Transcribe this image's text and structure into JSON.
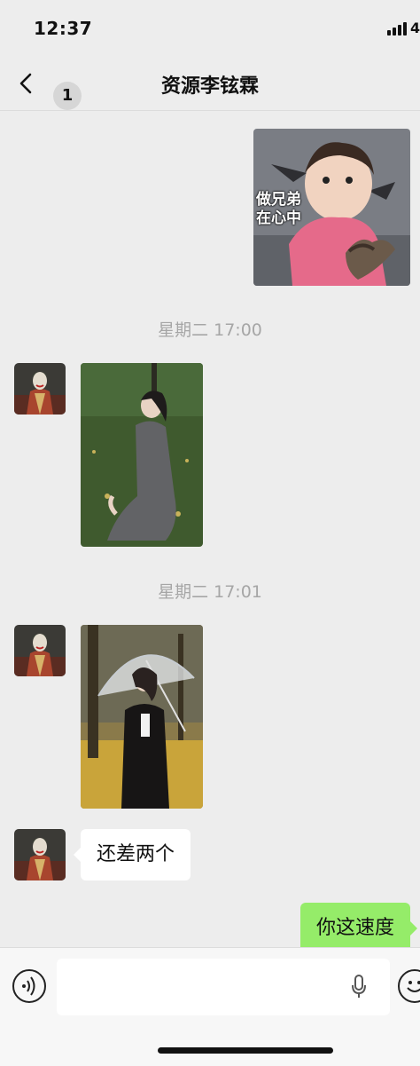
{
  "status_bar": {
    "time": "12:37",
    "network": "4"
  },
  "nav": {
    "back_count": "1",
    "title": "资源李铉霖"
  },
  "messages": {
    "sticker_caption_line1": "做兄弟",
    "sticker_caption_line2": "在心中",
    "timestamp1": "星期二 17:00",
    "timestamp2": "星期二 17:01",
    "text_left": "还差两个",
    "text_right": "你这速度"
  },
  "colors": {
    "background": "#ededed",
    "outgoing_bubble": "#95ec69",
    "incoming_bubble": "#ffffff"
  },
  "icons": [
    "back-chevron-icon",
    "voice-icon",
    "microphone-icon",
    "emoji-icon",
    "signal-icon"
  ]
}
